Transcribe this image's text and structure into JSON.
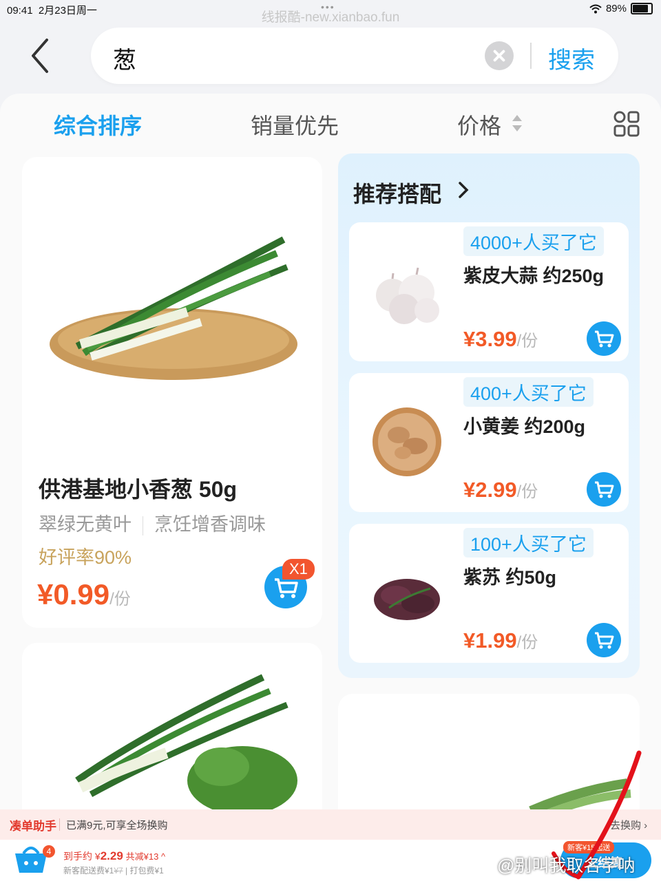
{
  "status_bar": {
    "time": "09:41",
    "date": "2月23日周一",
    "watermark": "线报酷-new.xianbao.fun",
    "battery": "89%"
  },
  "search": {
    "query": "葱",
    "button": "搜索"
  },
  "sort_tabs": {
    "comprehensive": "综合排序",
    "sales": "销量优先",
    "price": "价格"
  },
  "main_product": {
    "title": "供港基地小香葱 50g",
    "tag1": "翠绿无黄叶",
    "tag2": "烹饪增香调味",
    "rating": "好评率90%",
    "price": "¥0.99",
    "unit": "/份",
    "cart_qty": "X1"
  },
  "recommend": {
    "title": "推荐搭配",
    "items": [
      {
        "buyers": "4000+人买了它",
        "name": "紫皮大蒜 约250g",
        "price": "¥3.99",
        "unit": "/份"
      },
      {
        "buyers": "400+人买了它",
        "name": "小黄姜 约200g",
        "price": "¥2.99",
        "unit": "/份"
      },
      {
        "buyers": "100+人买了它",
        "name": "紫苏 约50g",
        "price": "¥1.99",
        "unit": "/份"
      }
    ]
  },
  "helper_bar": {
    "name": "凑单助手",
    "message": "已满9元,可享全场换购",
    "swap": "去换购 ›"
  },
  "bottom_bar": {
    "basket_count": "4",
    "total_prefix": "到手约 ¥",
    "total_amount": "2.29",
    "discount": "共减¥13 ^",
    "fee_prefix": "新客配送费¥1",
    "fee_struck": "¥7",
    "fee_suffix": " | 打包费¥1",
    "new_customer": "新客¥15起送",
    "checkout": "去结算"
  },
  "weibo_watermark": "@别叫我取名字呐",
  "colors": {
    "accent": "#1aa0ee",
    "price": "#f25a27",
    "rating": "#c8a35c"
  }
}
